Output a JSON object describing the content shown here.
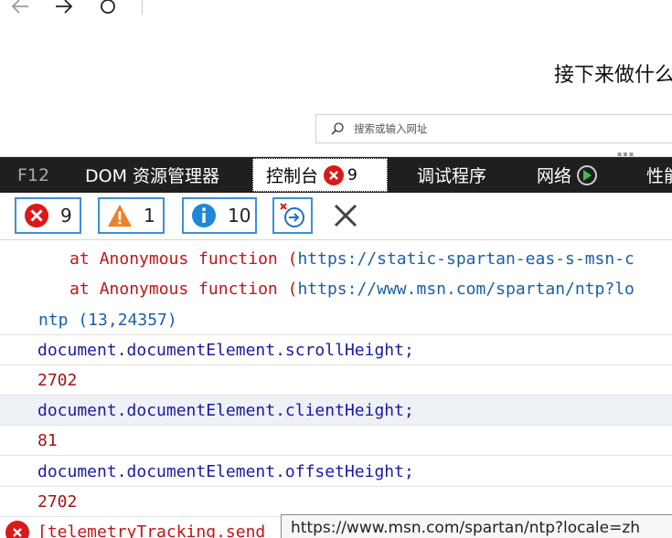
{
  "browser": {
    "page_heading": "接下来做什么",
    "search_placeholder": "搜索或输入网址"
  },
  "devtools": {
    "tabs": {
      "f12": "F12",
      "dom": "DOM 资源管理器",
      "console": "控制台",
      "console_errors": "9",
      "debugger": "调试程序",
      "network": "网络",
      "performance": "性能"
    },
    "toolbar": {
      "errors": "9",
      "warnings": "1",
      "info": "10"
    },
    "console_lines": {
      "l1_at": "at",
      "l1_fn": "Anonymous function (",
      "l1_url": "https://static-spartan-eas-s-msn-c",
      "l2_at": "at",
      "l2_fn": "Anonymous function (",
      "l2_url": "https://www.msn.com/spartan/ntp?lo",
      "l3": "ntp (13,24357)",
      "l4": "document.documentElement.scrollHeight;",
      "l5": "2702",
      "l6": "document.documentElement.clientHeight;",
      "l7": "81",
      "l8": "document.documentElement.offsetHeight;",
      "l9": "2702",
      "l10": "[telemetryTracking.send"
    },
    "tooltip": "https://www.msn.com/spartan/ntp?locale=zh"
  },
  "colors": {
    "error": "#d91a1a",
    "warning": "#e8832a",
    "info": "#1e88d8",
    "accent": "#3d8fd8",
    "tabbar": "#1f1f1f"
  }
}
